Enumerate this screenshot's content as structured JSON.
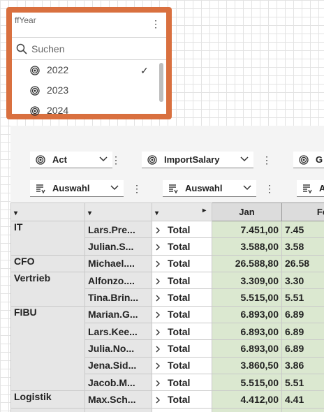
{
  "filter": {
    "title": "ffYear",
    "menu_icon": "⋮",
    "search_placeholder": "Suchen",
    "options": [
      {
        "label": "2022",
        "selected": true
      },
      {
        "label": "2023",
        "selected": false
      },
      {
        "label": "2024",
        "selected": false
      }
    ],
    "check_icon": "✓"
  },
  "toolbar": {
    "row1": [
      {
        "label": "Act"
      },
      {
        "label": "ImportSalary"
      },
      {
        "label": "G"
      }
    ],
    "row2": [
      {
        "label": "Auswahl"
      },
      {
        "label": "Auswahl"
      },
      {
        "label": "A"
      }
    ],
    "menu_icon": "⋮"
  },
  "table": {
    "header_arrows": [
      "▾",
      "▾",
      "▾",
      "▸"
    ],
    "months": [
      "Jan",
      "Feb"
    ],
    "rows": [
      {
        "dept": "IT",
        "person": "Lars.Pre...",
        "total": "Total",
        "jan": "7.451,00",
        "feb": "7.45"
      },
      {
        "dept": "",
        "person": "Julian.S...",
        "total": "Total",
        "jan": "3.588,00",
        "feb": "3.58"
      },
      {
        "dept": "CFO",
        "person": "Michael....",
        "total": "Total",
        "jan": "26.588,80",
        "feb": "26.58"
      },
      {
        "dept": "Vertrieb",
        "person": "Alfonzo....",
        "total": "Total",
        "jan": "3.309,00",
        "feb": "3.30"
      },
      {
        "dept": "",
        "person": "Tina.Brin...",
        "total": "Total",
        "jan": "5.515,00",
        "feb": "5.51"
      },
      {
        "dept": "FIBU",
        "person": "Marian.G...",
        "total": "Total",
        "jan": "6.893,00",
        "feb": "6.89"
      },
      {
        "dept": "",
        "person": "Lars.Kee...",
        "total": "Total",
        "jan": "6.893,00",
        "feb": "6.89"
      },
      {
        "dept": "",
        "person": "Julia.No...",
        "total": "Total",
        "jan": "6.893,00",
        "feb": "6.89"
      },
      {
        "dept": "",
        "person": "Jena.Sid...",
        "total": "Total",
        "jan": "3.860,50",
        "feb": "3.86"
      },
      {
        "dept": "",
        "person": "Jacob.M...",
        "total": "Total",
        "jan": "5.515,00",
        "feb": "5.51"
      },
      {
        "dept": "Logistik",
        "person": "Max.Sch...",
        "total": "Total",
        "jan": "4.412,00",
        "feb": "4.41"
      },
      {
        "dept": "",
        "person": "",
        "total": "",
        "jan": "",
        "feb": ""
      }
    ]
  },
  "colors": {
    "filter_border": "#d9703f",
    "value_cell": "#dbe8d0",
    "header_cell": "#e8e8e8"
  }
}
